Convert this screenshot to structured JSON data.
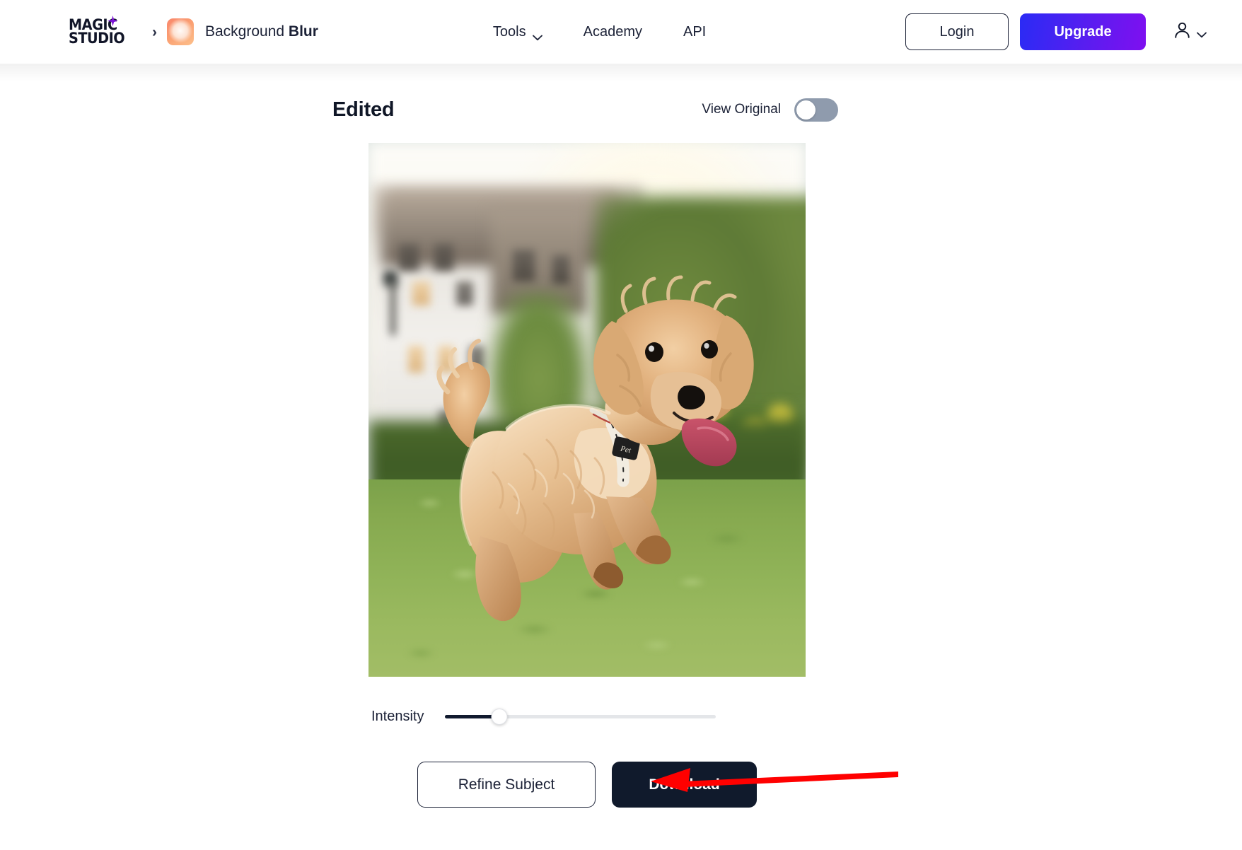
{
  "header": {
    "logo": {
      "line1": "MAGIC",
      "line2": "STUDIO",
      "star_color": "#7B14D6"
    },
    "breadcrumb": {
      "separator": "›",
      "tool_thumbnail": "blur-tool-thumbnail",
      "title_regular": "Background ",
      "title_bold": "Blur"
    },
    "nav": [
      {
        "label": "Tools",
        "has_dropdown": true
      },
      {
        "label": "Academy",
        "has_dropdown": false
      },
      {
        "label": "API",
        "has_dropdown": false
      }
    ],
    "login_label": "Login",
    "upgrade_label": "Upgrade",
    "upgrade_gradient_from": "#2a2bf5",
    "upgrade_gradient_to": "#7f0ff0",
    "account_icon": "person-icon",
    "account_chevron": "chevron-down-icon"
  },
  "editor": {
    "title": "Edited",
    "view_original_label": "View Original",
    "view_original_enabled": false,
    "image_alt": "running apricot poodle puppy in a park with blurred building and trees background",
    "slider": {
      "label": "Intensity",
      "value_percent": 20,
      "min": 0,
      "max": 100,
      "fill_color": "#111a2e",
      "track_color": "#e4e6e9"
    },
    "refine_label": "Refine Subject",
    "download_label": "Download",
    "download_bg": "#101a2c"
  },
  "annotation": {
    "arrow_color": "#ff0000",
    "points_to": "intensity-slider",
    "direction": "left"
  }
}
